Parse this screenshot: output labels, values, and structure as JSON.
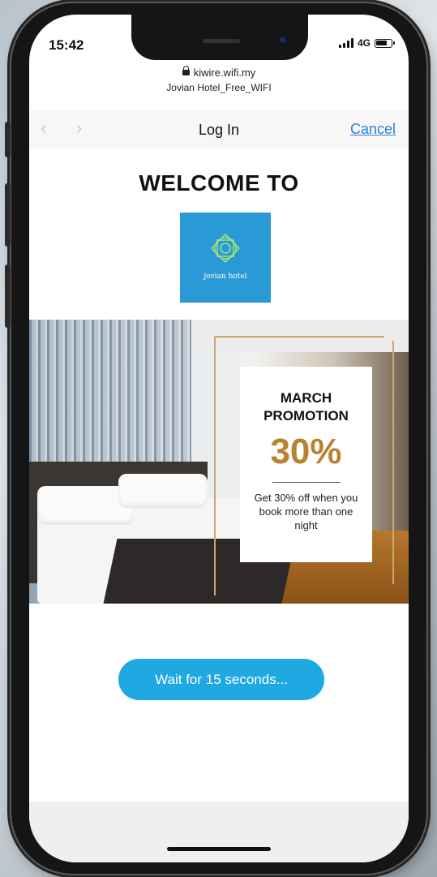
{
  "status_bar": {
    "time": "15:42",
    "network": "4G"
  },
  "browser": {
    "url": "kiwire.wifi.my",
    "ssid": "Jovian Hotel_Free_WIFI",
    "back_icon": "chevron-left-icon",
    "forward_icon": "chevron-right-icon",
    "title": "Log In",
    "cancel_label": "Cancel"
  },
  "page": {
    "welcome_heading": "WELCOME TO",
    "logo_text": "jovian hotel",
    "promo": {
      "title_line1": "MARCH",
      "title_line2": "PROMOTION",
      "discount": "30%",
      "description": "Get 30% off when you book more than one night"
    },
    "wait_button_label": "Wait for 15 seconds..."
  },
  "colors": {
    "accent_blue": "#1fa8e2",
    "logo_blue": "#2a9ad6",
    "link_blue": "#2b7fd6",
    "gold": "#b88330"
  }
}
